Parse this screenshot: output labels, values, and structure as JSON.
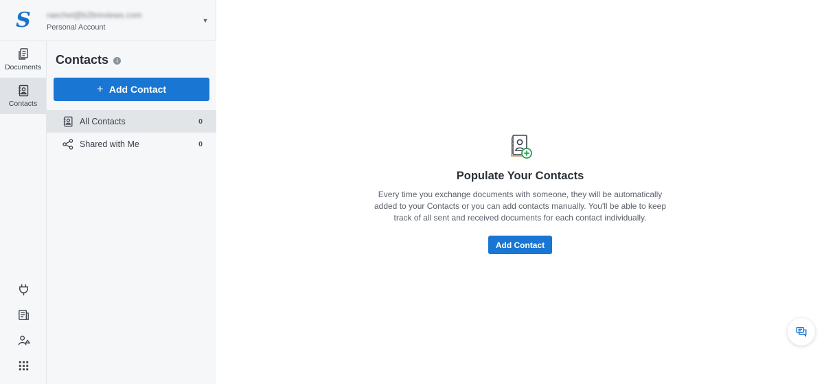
{
  "account": {
    "logo": "S",
    "email": "raechel@b2breviews.com",
    "type": "Personal Account",
    "caret_icon": "caret-down-icon"
  },
  "rail": {
    "items": [
      {
        "label": "Documents",
        "icon": "documents-icon",
        "active": false
      },
      {
        "label": "Contacts",
        "icon": "contacts-icon",
        "active": true
      }
    ],
    "bottom_icons": [
      "integrations-icon",
      "templates-icon",
      "team-icon",
      "apps-grid-icon"
    ]
  },
  "contacts_panel": {
    "title": "Contacts",
    "info_icon": "info-icon",
    "add_button": "Add Contact",
    "list": [
      {
        "label": "All Contacts",
        "count": "0",
        "icon": "contacts-icon",
        "active": true
      },
      {
        "label": "Shared with Me",
        "count": "0",
        "icon": "share-icon",
        "active": false
      }
    ]
  },
  "empty_state": {
    "icon": "add-contact-icon",
    "title": "Populate Your Contacts",
    "description": "Every time you exchange documents with someone, they will be automatically added to your Contacts or you can add contacts manually. You'll be able to keep track of all sent and received documents for each contact individually.",
    "button": "Add Contact"
  },
  "chat_button": {
    "icon": "chat-icon"
  },
  "colors": {
    "accent": "#1976d2",
    "sidebar_bg": "#f6f7f8",
    "active_bg": "#dfe2e6"
  }
}
